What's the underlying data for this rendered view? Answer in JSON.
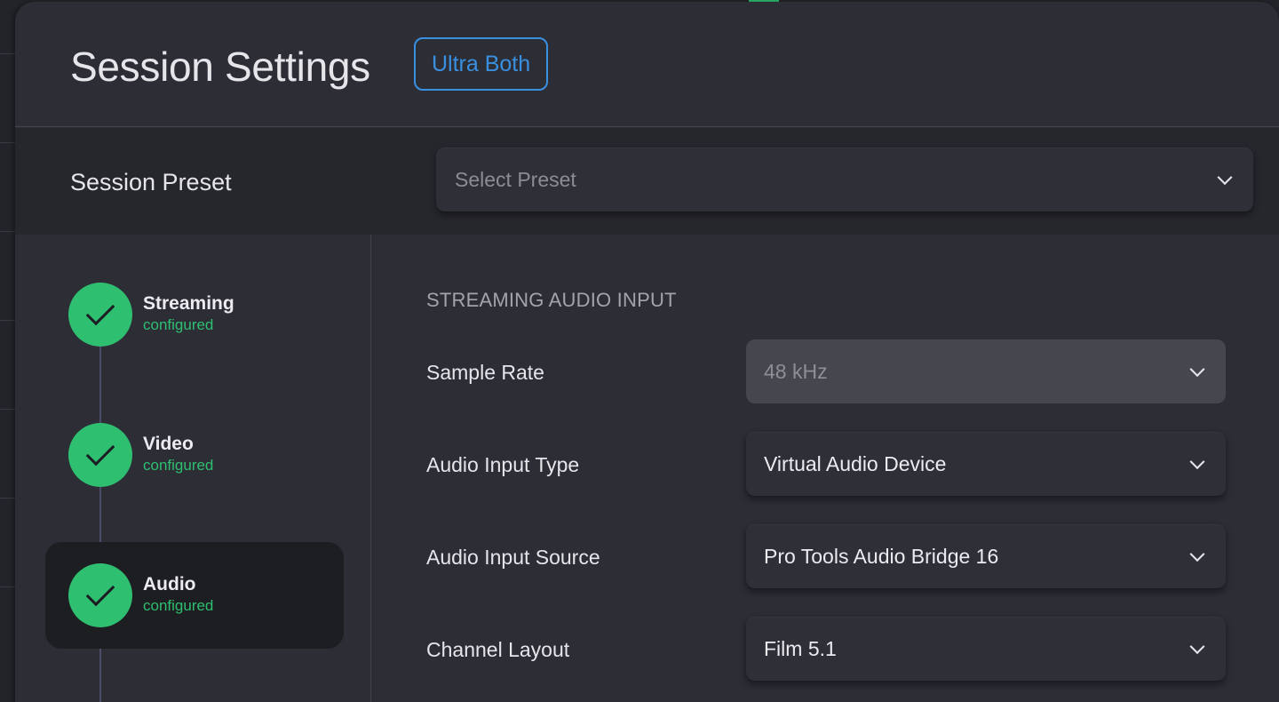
{
  "modal": {
    "title": "Session Settings",
    "tier_badge": "Ultra Both"
  },
  "preset": {
    "label": "Session Preset",
    "placeholder": "Select Preset"
  },
  "steps": [
    {
      "title": "Streaming",
      "status": "configured",
      "active": false
    },
    {
      "title": "Video",
      "status": "configured",
      "active": false
    },
    {
      "title": "Audio",
      "status": "configured",
      "active": true
    }
  ],
  "audio": {
    "section_title": "STREAMING AUDIO INPUT",
    "fields": [
      {
        "label": "Sample Rate",
        "value": "48 kHz",
        "disabled": true
      },
      {
        "label": "Audio Input Type",
        "value": "Virtual Audio Device",
        "disabled": false
      },
      {
        "label": "Audio Input Source",
        "value": "Pro Tools Audio Bridge 16",
        "disabled": false
      },
      {
        "label": "Channel Layout",
        "value": "Film 5.1",
        "disabled": false
      }
    ]
  },
  "colors": {
    "accent_blue": "#3a90e0",
    "success_green": "#2fbf71",
    "modal_bg": "#2c2d35"
  }
}
